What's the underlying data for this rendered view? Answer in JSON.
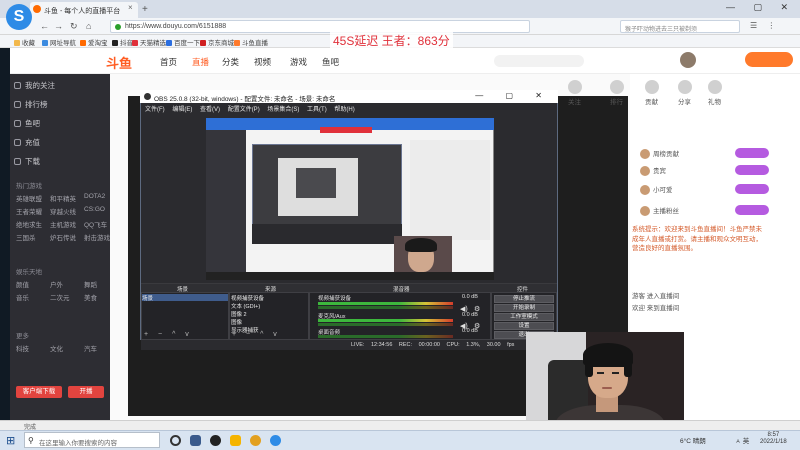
{
  "browser": {
    "tab_title": "斗鱼 - 每个人的直播平台",
    "url": "https://www.douyu.com/6151888",
    "search_placeholder": "猴子吓动物进去三只被剃须",
    "logo_letter": "S",
    "nav_back": "←",
    "nav_forward": "→",
    "nav_refresh": "↻",
    "nav_home": "⌂",
    "window_controls": "— ▢ ✕",
    "right_nav": "☰ ⋮",
    "bookmarks": [
      "收藏",
      "网址导航",
      "爱淘宝",
      "抖音",
      "天猫精选",
      "百度一下",
      "京东商城",
      "斗鱼直播"
    ],
    "status_text": "完成"
  },
  "overlay_text": "45S延迟 王者：863分",
  "douyu": {
    "logo": "斗鱼",
    "nav": [
      "首页",
      "直播",
      "分类",
      "视频",
      "游戏",
      "鱼吧"
    ],
    "active_nav": 1,
    "sidebar_items": [
      "我的关注",
      "排行榜",
      "鱼吧",
      "充值",
      "下载"
    ],
    "sidebar_head1": "热门游戏",
    "sidebar_games": [
      "英雄联盟",
      "和平精英",
      "DOTA2",
      "王者荣耀",
      "穿越火线",
      "CS:GO",
      "绝地求生",
      "主机游戏",
      "QQ飞车",
      "三国杀",
      "炉石传说",
      "射击游戏"
    ],
    "sidebar_head2": "娱乐天地",
    "sidebar_ents": [
      "颜值",
      "户外",
      "舞蹈",
      "音乐",
      "二次元",
      "美食"
    ],
    "sidebar_head3": "更多",
    "sidebar_more": [
      "科技",
      "文化",
      "汽车"
    ],
    "sidebar_btn1": "客户端下载",
    "sidebar_btn2": "开播",
    "right_icons": [
      "关注",
      "排行",
      "贡献",
      "分享",
      "礼物"
    ],
    "rank_rows": [
      "周榜贡献",
      "贵宾",
      "小可爱",
      "主播粉丝"
    ],
    "chat_notice": "系统提示：欢迎来到斗鱼直播间！斗鱼严禁未成年人直播或打赏。请主播和观众文明互动，营造良好的直播氛围。",
    "chat_lines": [
      "游客 进入直播间",
      "欢迎 来到直播间"
    ]
  },
  "obs": {
    "title": "OBS 25.0.8 (32-bit, windows) - 配置文件: 未命名 - 场景: 未命名",
    "menu": [
      "文件(F)",
      "编辑(E)",
      "查看(V)",
      "配置文件(P)",
      "场景集合(S)",
      "工具(T)",
      "帮助(H)"
    ],
    "window_controls": "— ▢ ✕",
    "dock_titles": {
      "scenes": "场景",
      "sources": "来源",
      "mixer": "混音器",
      "controls": "控件"
    },
    "scene_name": "场景",
    "sources": [
      "视频捕获设备",
      "文本 (GDI+)",
      "图像 2",
      "图像",
      "显示器捕获"
    ],
    "mixer": [
      {
        "name": "视频捕获设备",
        "db": "0.0 dB"
      },
      {
        "name": "麦克风/Aux",
        "db": "0.0 dB"
      },
      {
        "name": "桌面音频",
        "db": "0.0 dB"
      }
    ],
    "control_buttons": [
      "停止推流",
      "开始录制",
      "工作室模式",
      "设置",
      "退出"
    ],
    "status_bar": "LIVE: 12:34:56 REC: 00:00:00 CPU: 1.3%, 30.00 fps",
    "dock_ctrls": "+ − ^ v"
  },
  "taskbar": {
    "start_icon": "⊞",
    "search_icon": "⚲",
    "search_placeholder": "在这里输入你要搜索的内容",
    "weather": "6°C 晴朗",
    "tray": "ㅅ 英",
    "time": "8:57",
    "date": "2022/1/18"
  }
}
